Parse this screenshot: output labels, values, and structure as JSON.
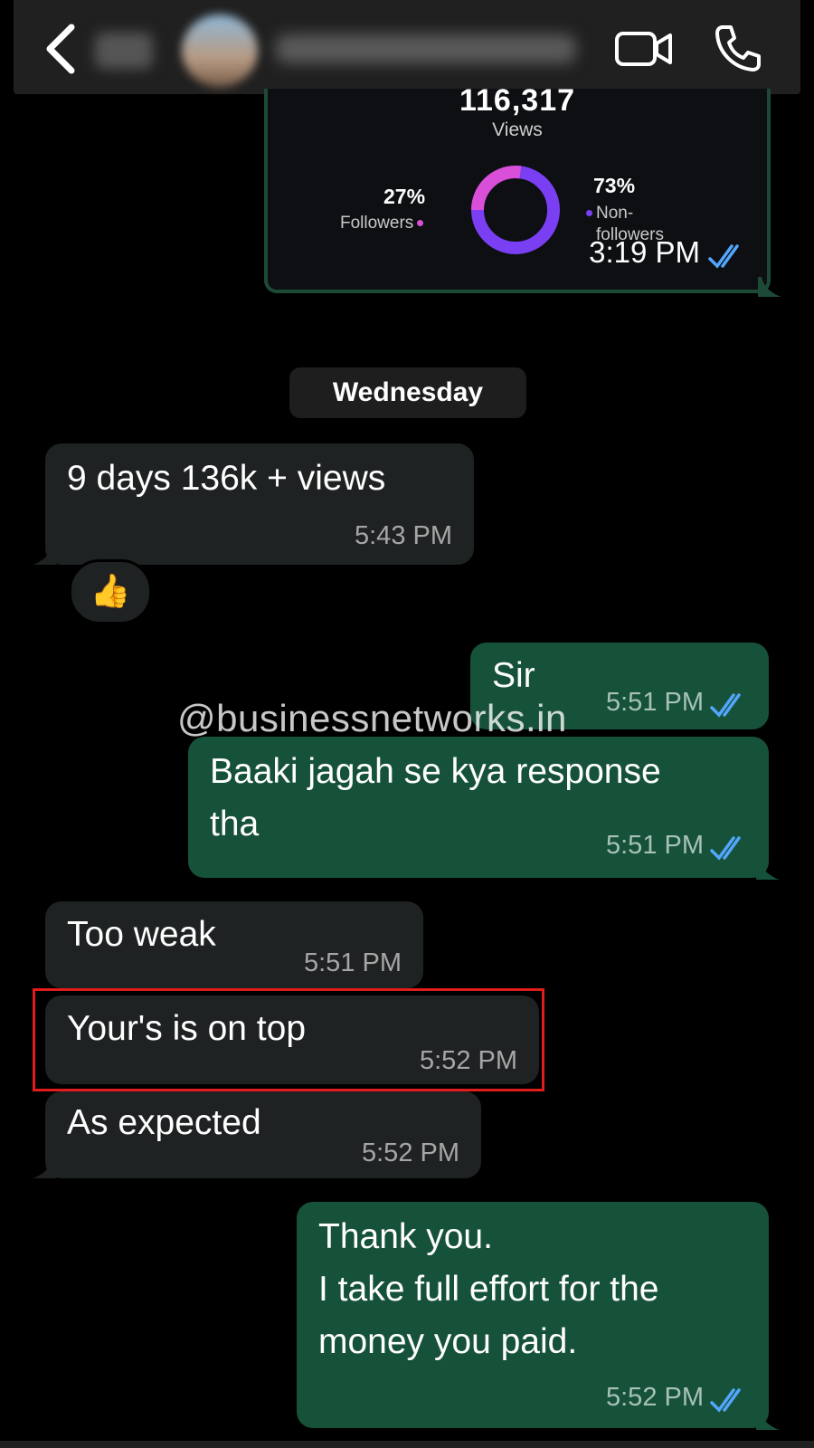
{
  "header": {
    "back_icon": "chevron-left-icon",
    "video_icon": "video-camera-icon",
    "phone_icon": "phone-icon"
  },
  "insights_card": {
    "views_number": "116,317",
    "views_label": "Views",
    "followers_pct": "27%",
    "followers_label": "Followers",
    "nonfollowers_pct": "73%",
    "nonfollowers_label": "Non-\nfollowers",
    "followers_fraction": 0.27,
    "nonfollowers_fraction": 0.73,
    "time": "3:19 PM",
    "colors": {
      "followers": "#d94fd8",
      "nonfollowers": "#7a3ff2"
    }
  },
  "day_separator": "Wednesday",
  "messages": [
    {
      "direction": "incoming",
      "text": "9 days 136k + views",
      "time": "5:43 PM",
      "reaction": "👍"
    },
    {
      "direction": "outgoing",
      "text": "Sir",
      "time": "5:51 PM",
      "read": true
    },
    {
      "direction": "outgoing",
      "text": "Baaki jagah se kya response\ntha",
      "time": "5:51 PM",
      "read": true
    },
    {
      "direction": "incoming",
      "text": "Too weak",
      "time": "5:51 PM"
    },
    {
      "direction": "incoming",
      "text": "Your's is on top",
      "time": "5:52 PM",
      "highlighted": true
    },
    {
      "direction": "incoming",
      "text": "As expected",
      "time": "5:52 PM"
    },
    {
      "direction": "outgoing",
      "text": "Thank you.\nI take full effort for the\nmoney you paid.",
      "time": "5:52 PM",
      "read": true
    }
  ],
  "watermark": "@businessnetworks.in",
  "colors": {
    "background": "#000000",
    "incoming_bubble": "#1f2223",
    "outgoing_bubble": "#165239",
    "read_receipt": "#53a6fd",
    "highlight": "#e01c1c"
  }
}
